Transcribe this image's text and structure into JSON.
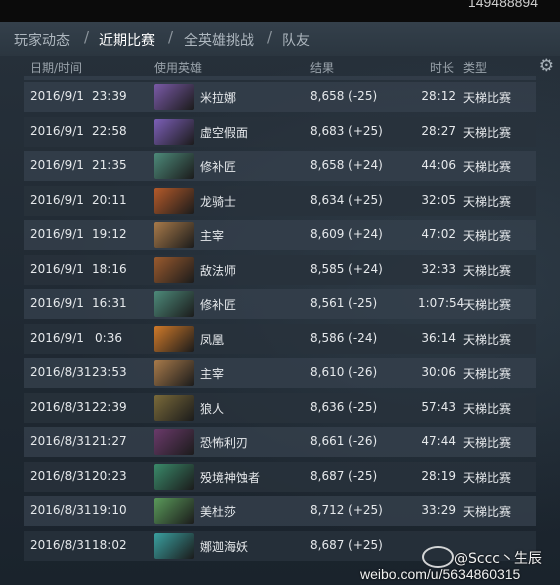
{
  "top_number": "149488894",
  "tabs": [
    {
      "label": "玩家动态"
    },
    {
      "label": "近期比赛"
    },
    {
      "label": "全英雄挑战"
    },
    {
      "label": "队友"
    }
  ],
  "columns": {
    "date_time": "日期/时间",
    "hero": "使用英雄",
    "result": "结果",
    "duration": "时长",
    "type": "类型"
  },
  "colors": {
    "win": "#7fd16a",
    "loss": "#e4493f"
  },
  "rows": [
    {
      "date": "2016/9/1",
      "time": "23:39",
      "hero": "米拉娜",
      "hero_color": "#7a5aa8",
      "result": "8,658 (-25)",
      "outcome": "loss",
      "duration": "28:12",
      "type": "天梯比赛"
    },
    {
      "date": "2016/9/1",
      "time": "22:58",
      "hero": "虚空假面",
      "hero_color": "#7c5fb8",
      "result": "8,683 (+25)",
      "outcome": "win",
      "duration": "28:27",
      "type": "天梯比赛"
    },
    {
      "date": "2016/9/1",
      "time": "21:35",
      "hero": "修补匠",
      "hero_color": "#4d8a7a",
      "result": "8,658 (+24)",
      "outcome": "win",
      "duration": "44:06",
      "type": "天梯比赛"
    },
    {
      "date": "2016/9/1",
      "time": "20:11",
      "hero": "龙骑士",
      "hero_color": "#b55a2a",
      "result": "8,634 (+25)",
      "outcome": "win",
      "duration": "32:05",
      "type": "天梯比赛"
    },
    {
      "date": "2016/9/1",
      "time": "19:12",
      "hero": "主宰",
      "hero_color": "#a87a4a",
      "result": "8,609 (+24)",
      "outcome": "win",
      "duration": "47:02",
      "type": "天梯比赛"
    },
    {
      "date": "2016/9/1",
      "time": "18:16",
      "hero": "敌法师",
      "hero_color": "#9a5a2e",
      "result": "8,585 (+24)",
      "outcome": "win",
      "duration": "32:33",
      "type": "天梯比赛"
    },
    {
      "date": "2016/9/1",
      "time": "16:31",
      "hero": "修补匠",
      "hero_color": "#4d8a7a",
      "result": "8,561 (-25)",
      "outcome": "loss",
      "duration": "1:07:54",
      "type": "天梯比赛"
    },
    {
      "date": "2016/9/1",
      "time": "0:36",
      "hero": "凤凰",
      "hero_color": "#d07a2a",
      "result": "8,586 (-24)",
      "outcome": "loss",
      "duration": "36:14",
      "type": "天梯比赛"
    },
    {
      "date": "2016/8/31",
      "time": "23:53",
      "hero": "主宰",
      "hero_color": "#a87a4a",
      "result": "8,610 (-26)",
      "outcome": "loss",
      "duration": "30:06",
      "type": "天梯比赛"
    },
    {
      "date": "2016/8/31",
      "time": "22:39",
      "hero": "狼人",
      "hero_color": "#7a6a3a",
      "result": "8,636 (-25)",
      "outcome": "loss",
      "duration": "57:43",
      "type": "天梯比赛"
    },
    {
      "date": "2016/8/31",
      "time": "21:27",
      "hero": "恐怖利刃",
      "hero_color": "#6a3a6a",
      "result": "8,661 (-26)",
      "outcome": "loss",
      "duration": "47:44",
      "type": "天梯比赛"
    },
    {
      "date": "2016/8/31",
      "time": "20:23",
      "hero": "殁境神蚀者",
      "hero_color": "#3a8a6a",
      "result": "8,687 (-25)",
      "outcome": "loss",
      "duration": "28:19",
      "type": "天梯比赛"
    },
    {
      "date": "2016/8/31",
      "time": "19:10",
      "hero": "美杜莎",
      "hero_color": "#5a9a5a",
      "result": "8,712 (+25)",
      "outcome": "win",
      "duration": "33:29",
      "type": "天梯比赛"
    },
    {
      "date": "2016/8/31",
      "time": "18:02",
      "hero": "娜迦海妖",
      "hero_color": "#3aa0a0",
      "result": "8,687 (+25)",
      "outcome": "win",
      "duration": "",
      "type": ""
    }
  ],
  "watermark": {
    "line1": "@Sccc丶生辰",
    "line2": "weibo.com/u/5634860315"
  }
}
